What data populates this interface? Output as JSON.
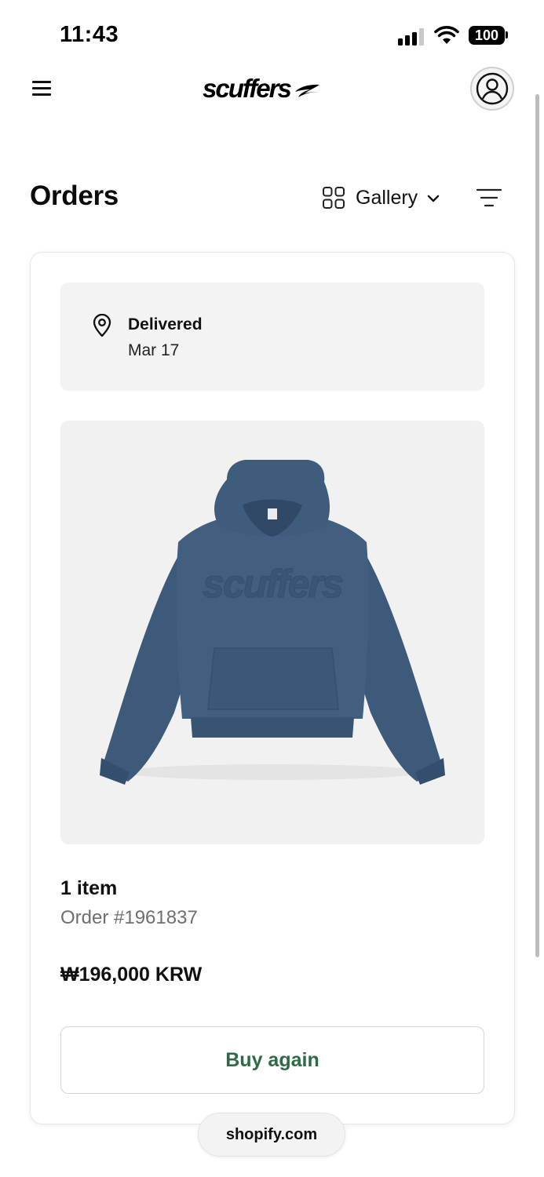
{
  "status_bar": {
    "time": "11:43",
    "battery": "100",
    "icons": [
      "signal-icon",
      "wifi-icon",
      "battery-icon"
    ]
  },
  "header": {
    "logo_text": "scuffers",
    "icons": [
      "menu-icon",
      "account-icon"
    ]
  },
  "page": {
    "title": "Orders",
    "view_label": "Gallery",
    "icons": [
      "grid-icon",
      "chevron-down-icon",
      "filter-icon"
    ]
  },
  "order": {
    "status": "Delivered",
    "status_date": "Mar 17",
    "status_icon": "location-pin-icon",
    "product_image": "navy-hoodie",
    "product_color": "#3f5c7e",
    "item_count": "1 item",
    "order_number": "Order #1961837",
    "total": "₩196,000 KRW",
    "buy_again_label": "Buy again",
    "accent_color": "#2e6a45"
  },
  "footer": {
    "shopify_label": "shopify.com"
  }
}
